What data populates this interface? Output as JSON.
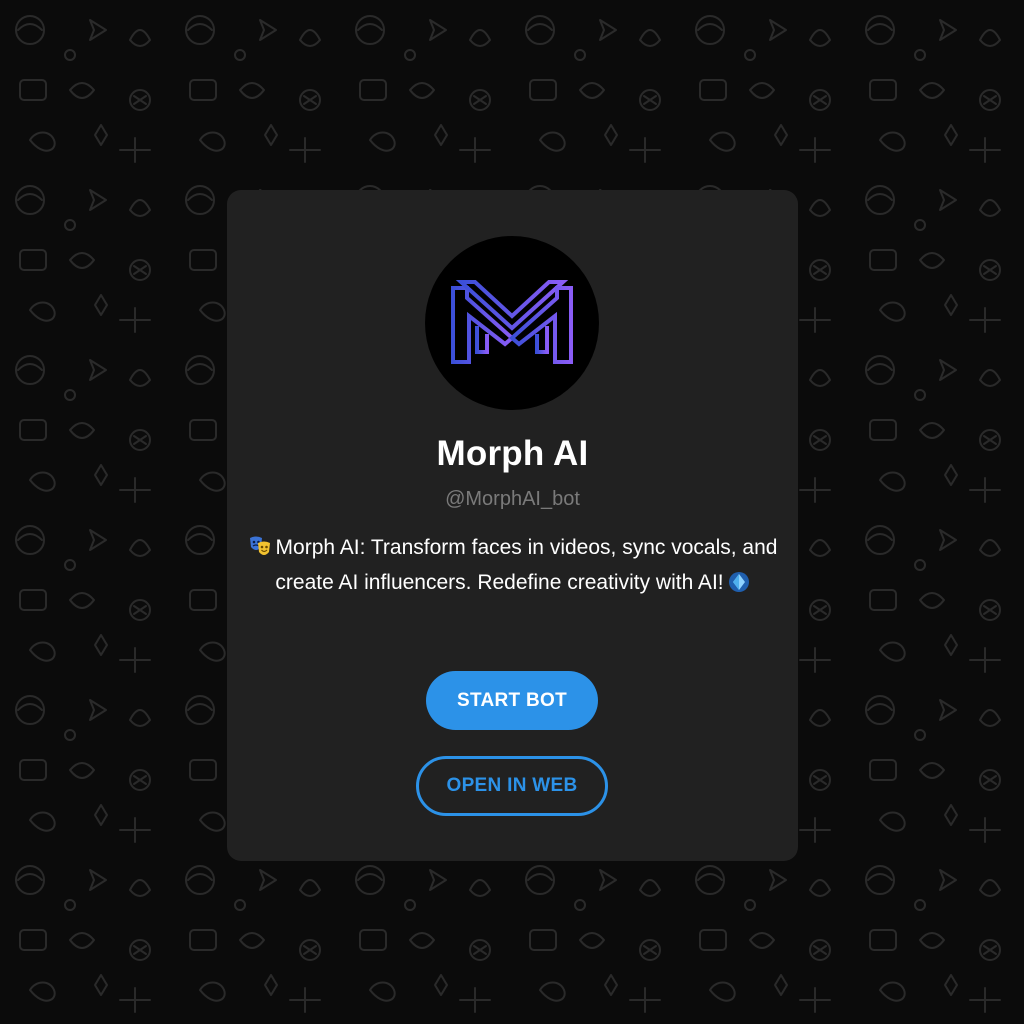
{
  "bot": {
    "name": "Morph AI",
    "username": "@MorphAI_bot",
    "description": "Morph AI: Transform faces in videos, sync vocals, and create AI influencers. Redefine creativity with AI!"
  },
  "icons": {
    "avatar": "morph-ai-logo",
    "leading_emoji": "performing-arts-masks-emoji",
    "trailing_emoji": "blue-gem-emoji"
  },
  "actions": {
    "start_label": "START BOT",
    "web_label": "OPEN IN WEB"
  },
  "colors": {
    "background": "#0b0b0b",
    "card": "#212121",
    "accent": "#2c92e8",
    "username": "#7a7a7a",
    "logo_gradient_start": "#3b4fd8",
    "logo_gradient_end": "#8a5cf6"
  }
}
